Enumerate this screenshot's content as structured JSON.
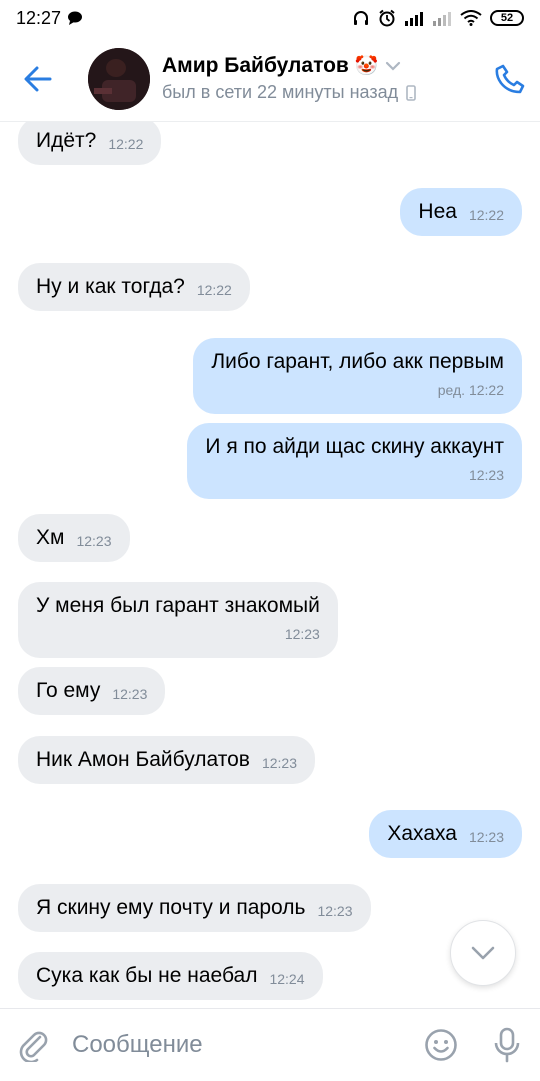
{
  "status_bar": {
    "time": "12:27",
    "battery": "52",
    "icons": [
      "chat-bubble-icon",
      "headphones-icon",
      "alarm-icon",
      "signal-icon",
      "signal-icon",
      "wifi-icon"
    ]
  },
  "header": {
    "contact_name": "Амир Байбулатов",
    "emoji": "🤡",
    "status": "был в сети 22 минуты назад",
    "back_icon": "back-arrow-icon",
    "phone_icon": "phone-icon",
    "accent_color": "#2a7de1"
  },
  "messages": [
    {
      "dir": "in",
      "text": "Идёт?",
      "time": "12:22"
    },
    {
      "dir": "out",
      "text": "Неа",
      "time": "12:22"
    },
    {
      "dir": "in",
      "text": "Ну и как тогда?",
      "time": "12:22"
    },
    {
      "dir": "out",
      "text": "Либо гарант, либо акк первым",
      "time": "ред. 12:22"
    },
    {
      "dir": "out",
      "text": "И я по айди щас скину аккаунт",
      "time": "12:23"
    },
    {
      "dir": "in",
      "text": "Хм",
      "time": "12:23"
    },
    {
      "dir": "in",
      "text": "У меня был гарант знакомый",
      "time": "12:23"
    },
    {
      "dir": "in",
      "text": "Го ему",
      "time": "12:23"
    },
    {
      "dir": "in",
      "text": "Ник Амон Байбулатов",
      "time": "12:23"
    },
    {
      "dir": "out",
      "text": "Хахаха",
      "time": "12:23"
    },
    {
      "dir": "in",
      "text": "Я скину ему почту и пароль",
      "time": "12:23"
    },
    {
      "dir": "in",
      "text": "Сука как бы не наебал",
      "time": "12:24"
    }
  ],
  "composer": {
    "placeholder": "Сообщение",
    "attach_icon": "paperclip-icon",
    "emoji_icon": "smile-icon",
    "mic_icon": "microphone-icon"
  },
  "colors": {
    "incoming_bubble": "#ebedf0",
    "outgoing_bubble": "#cce4ff",
    "secondary_text": "#818c99"
  }
}
